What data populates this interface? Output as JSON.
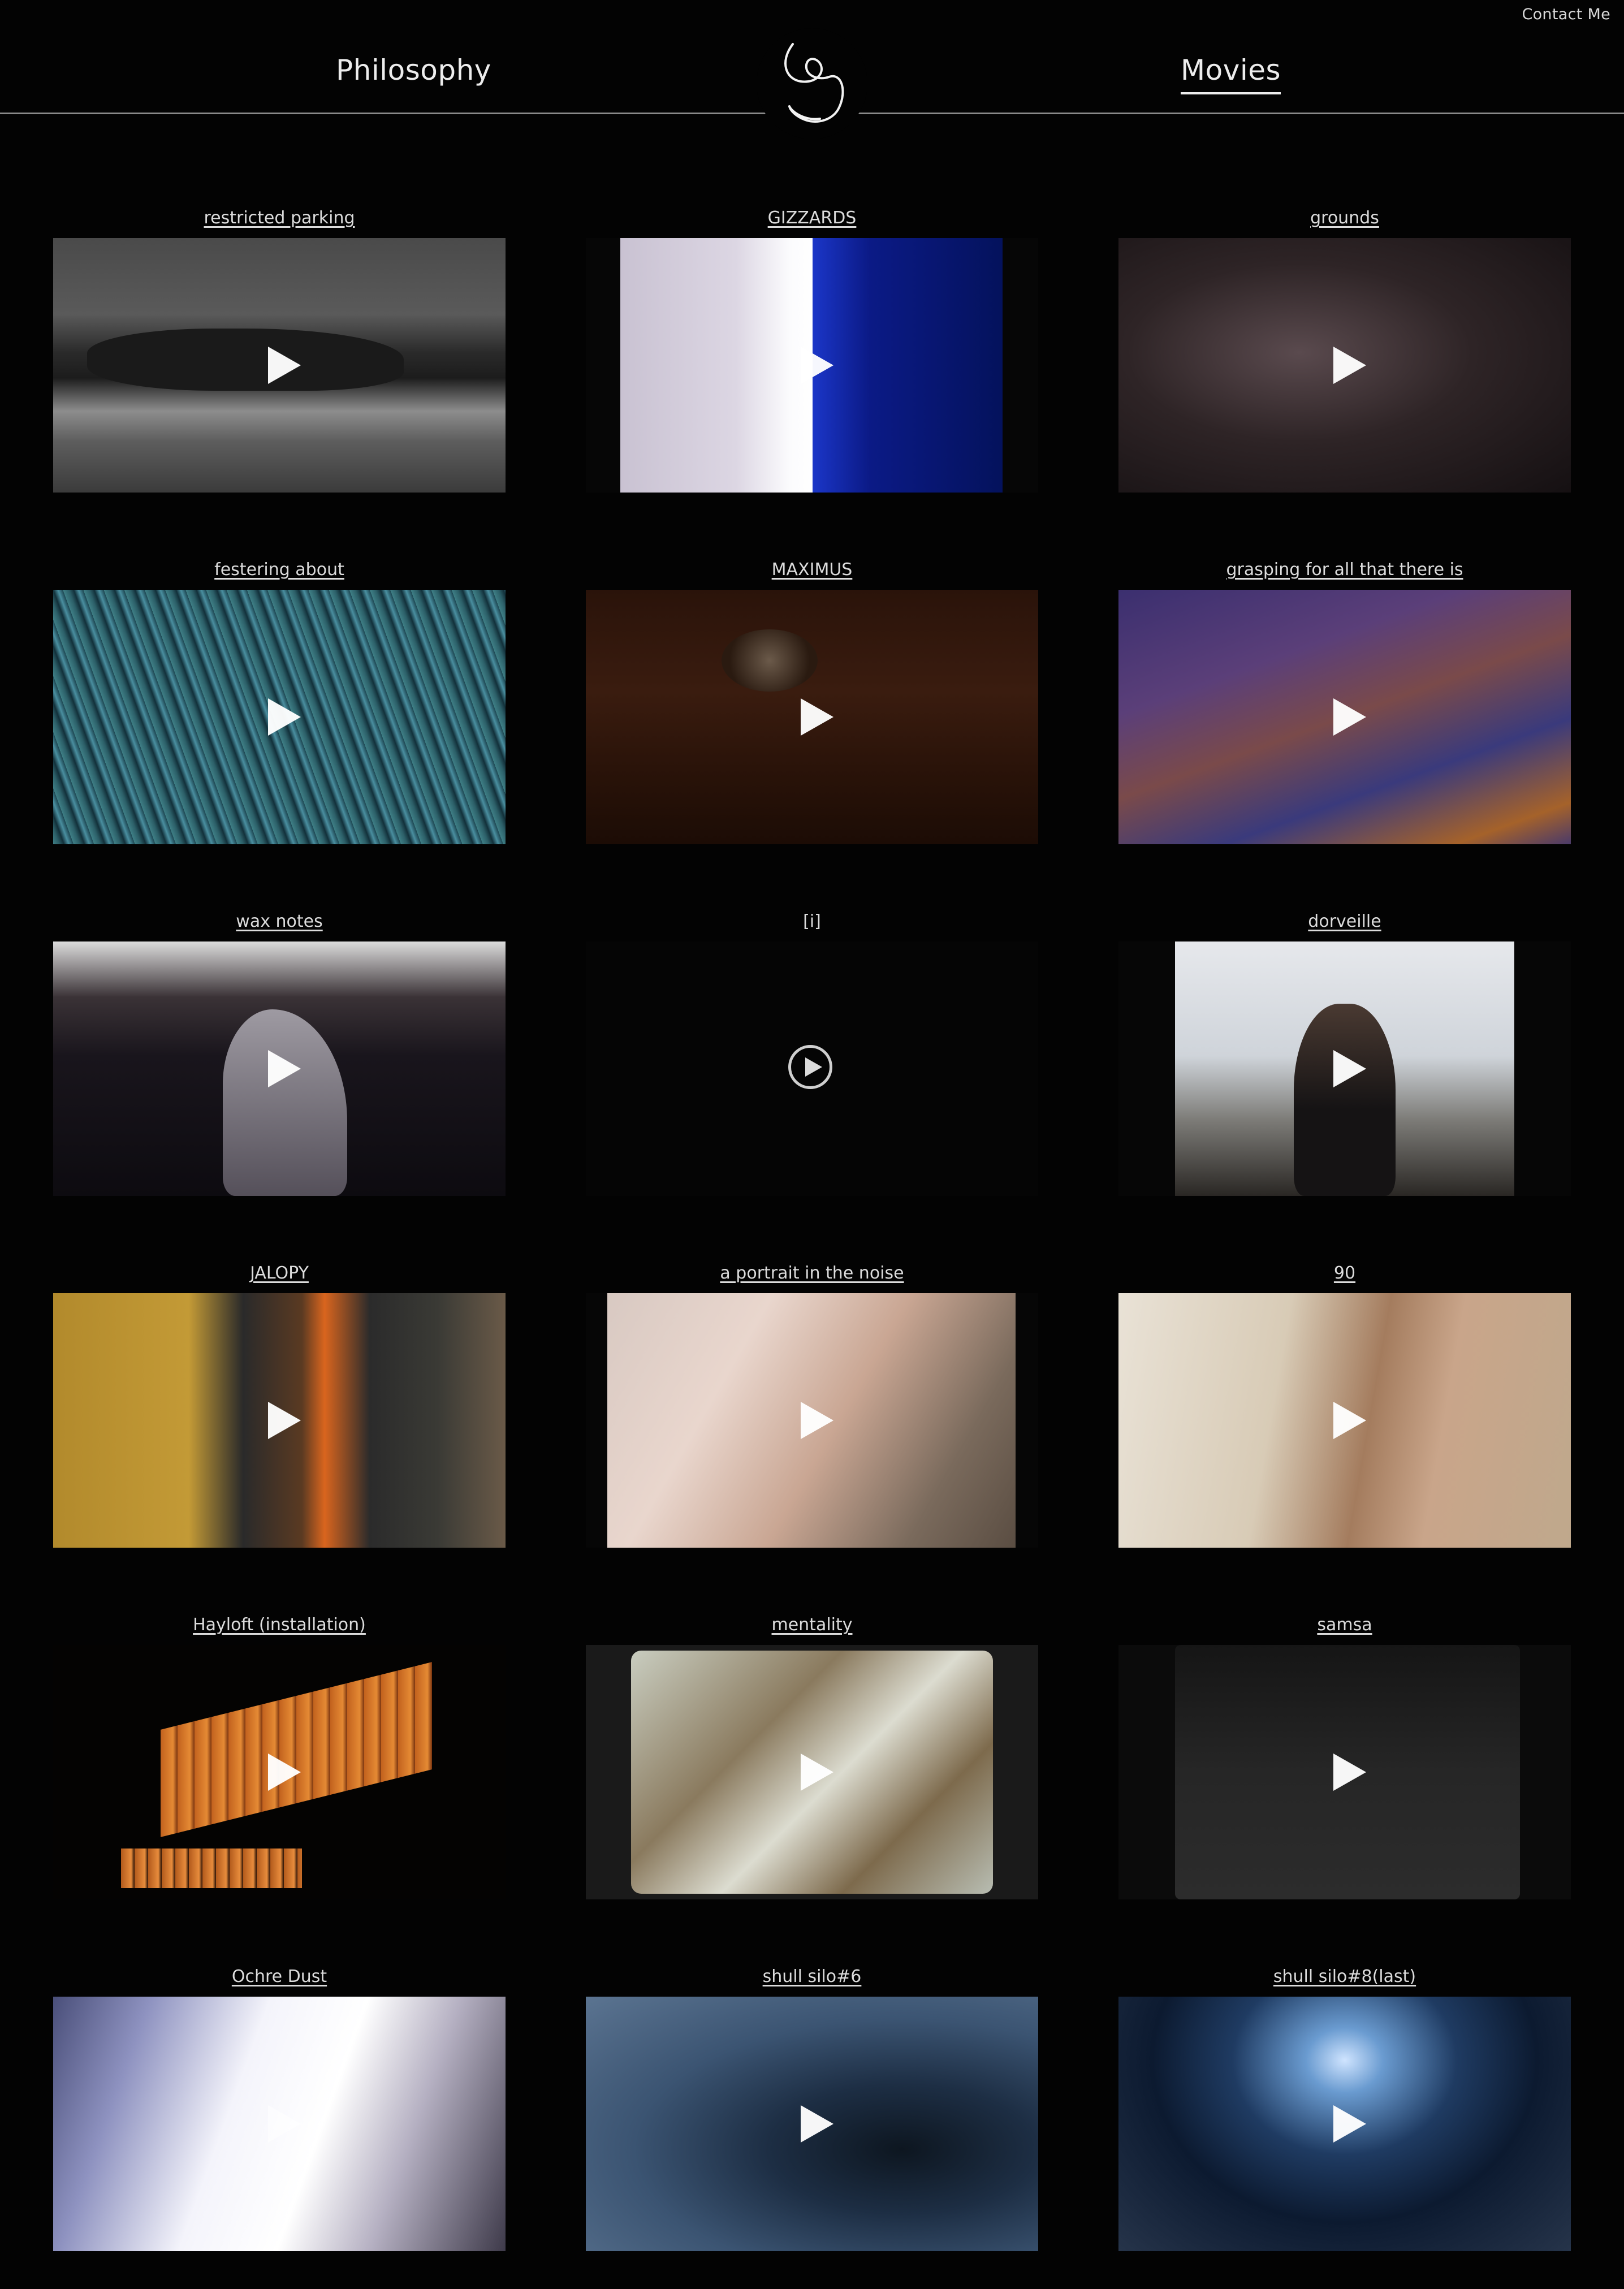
{
  "header": {
    "contact_label": "Contact Me",
    "nav": {
      "philosophy_label": "Philosophy",
      "movies_label": "Movies"
    },
    "active_tab": "Movies",
    "logo": "scribble-logo"
  },
  "colors": {
    "background": "#030303",
    "text": "#e6e6e6",
    "rule": "#8a8a8a"
  },
  "movies": [
    {
      "title": "restricted parking",
      "thumb": "grey-surf-rocks"
    },
    {
      "title": "GIZZARDS",
      "thumb": "white-blue-split"
    },
    {
      "title": "grounds",
      "thumb": "dark-leaf-litter"
    },
    {
      "title": "festering about",
      "thumb": "blue-green-grass"
    },
    {
      "title": "MAXIMUS",
      "thumb": "slug-on-wood"
    },
    {
      "title": "grasping for all that there is",
      "thumb": "purple-orange-smear"
    },
    {
      "title": "wax notes",
      "thumb": "wax-silhouette"
    },
    {
      "title": "[i]",
      "thumb": "black-frame"
    },
    {
      "title": "dorveille",
      "thumb": "woman-bare-trees"
    },
    {
      "title": "JALOPY",
      "thumb": "firefighter-jones"
    },
    {
      "title": "a portrait in the noise",
      "thumb": "glitched-portrait"
    },
    {
      "title": "90",
      "thumb": "hands-playing-cards"
    },
    {
      "title": "Hayloft (installation)",
      "thumb": "burning-slats"
    },
    {
      "title": "mentality",
      "thumb": "film-frame-rocks"
    },
    {
      "title": "samsa",
      "thumb": "dark-fabric-fold"
    },
    {
      "title": "Ochre Dust",
      "thumb": "backlit-figure"
    },
    {
      "title": "shull silo#6",
      "thumb": "wet-stone-blue"
    },
    {
      "title": "shull silo#8(last)",
      "thumb": "silo-ladder-blue"
    }
  ]
}
